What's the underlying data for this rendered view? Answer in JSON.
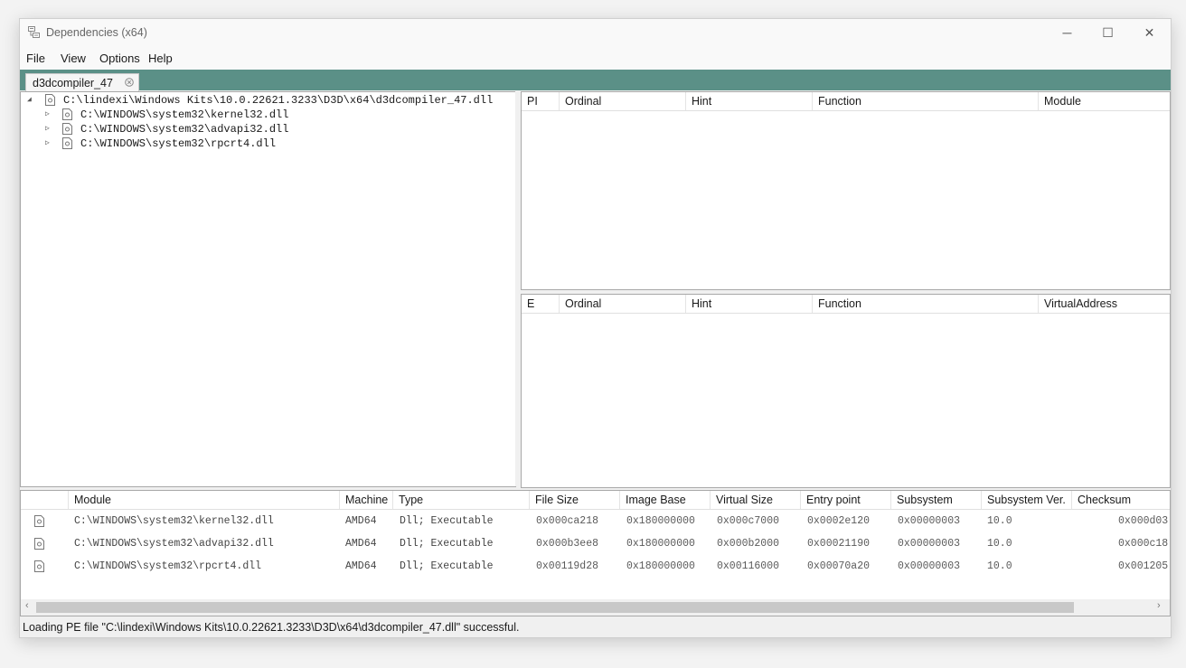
{
  "window": {
    "title": "Dependencies (x64)",
    "controls": {
      "minimize": "─",
      "maximize": "☐",
      "close": "✕"
    }
  },
  "menu": [
    "File",
    "View",
    "Options",
    "Help"
  ],
  "tabs": [
    {
      "label": "d3dcompiler_47",
      "active": true
    }
  ],
  "tree": {
    "root": {
      "label": "C:\\lindexi\\Windows Kits\\10.0.22621.3233\\D3D\\x64\\d3dcompiler_47.dll",
      "expanded": true
    },
    "children": [
      {
        "label": "C:\\WINDOWS\\system32\\kernel32.dll"
      },
      {
        "label": "C:\\WINDOWS\\system32\\advapi32.dll"
      },
      {
        "label": "C:\\WINDOWS\\system32\\rpcrt4.dll"
      }
    ]
  },
  "imports_columns": [
    "PI",
    "Ordinal",
    "Hint",
    "Function",
    "Module"
  ],
  "exports_columns": [
    "E",
    "Ordinal",
    "Hint",
    "Function",
    "VirtualAddress"
  ],
  "modules": {
    "columns": [
      "",
      "Module",
      "Machine",
      "Type",
      "File Size",
      "Image Base",
      "Virtual Size",
      "Entry point",
      "Subsystem",
      "Subsystem Ver.",
      "Checksum"
    ],
    "rows": [
      [
        "C:\\WINDOWS\\system32\\kernel32.dll",
        "AMD64",
        "Dll; Executable",
        "0x000ca218",
        "0x180000000",
        "0x000c7000",
        "0x0002e120",
        "0x00000003",
        "10.0",
        "0x000d03"
      ],
      [
        "C:\\WINDOWS\\system32\\advapi32.dll",
        "AMD64",
        "Dll; Executable",
        "0x000b3ee8",
        "0x180000000",
        "0x000b2000",
        "0x00021190",
        "0x00000003",
        "10.0",
        "0x000c18"
      ],
      [
        "C:\\WINDOWS\\system32\\rpcrt4.dll",
        "AMD64",
        "Dll; Executable",
        "0x00119d28",
        "0x180000000",
        "0x00116000",
        "0x00070a20",
        "0x00000003",
        "10.0",
        "0x001205"
      ]
    ]
  },
  "status": "Loading PE file \"C:\\lindexi\\Windows Kits\\10.0.22621.3233\\D3D\\x64\\d3dcompiler_47.dll\" successful.",
  "colors": {
    "tab_strip": "#5b9087",
    "panel_border": "#a8a8a8"
  },
  "icons": {
    "app": "dependencies-app-icon",
    "file": "dll-file-icon",
    "tab_close": "close-circle-icon"
  }
}
